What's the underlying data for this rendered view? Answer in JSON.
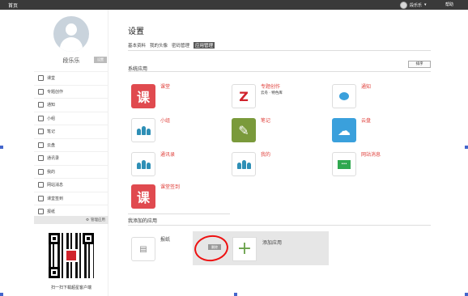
{
  "topbar": {
    "home": "首页",
    "user": "段乐乐",
    "help": "帮助"
  },
  "sidebar": {
    "username": "段乐乐",
    "settings_badge": "设置",
    "items": [
      {
        "label": "课堂",
        "icon": "book-icon"
      },
      {
        "label": "专题创作",
        "icon": "topic-icon"
      },
      {
        "label": "通知",
        "icon": "bell-icon"
      },
      {
        "label": "小组",
        "icon": "group-icon"
      },
      {
        "label": "笔记",
        "icon": "note-icon"
      },
      {
        "label": "云盘",
        "icon": "cloud-icon"
      },
      {
        "label": "通讯录",
        "icon": "contacts-icon"
      },
      {
        "label": "我的",
        "icon": "user-icon"
      },
      {
        "label": "网站消息",
        "icon": "message-icon"
      },
      {
        "label": "课堂签到",
        "icon": "checkin-icon"
      },
      {
        "label": "报纸",
        "icon": "newspaper-icon"
      }
    ],
    "manage_apps": "管理应用",
    "qr_caption": "扫一扫下载超星客户端"
  },
  "main": {
    "title": "设置",
    "tabs": [
      "基本资料",
      "我的头像",
      "密码管理",
      "应用管理"
    ],
    "active_tab": 3,
    "system_apps_label": "系统应用",
    "sort_button": "排序",
    "apps": [
      {
        "label": "课堂",
        "glyph": "课"
      },
      {
        "label": "专题创作",
        "sub": "云舟 · 特色库",
        "glyph": "Z"
      },
      {
        "label": "通知",
        "glyph": ""
      },
      {
        "label": "小组",
        "glyph": ""
      },
      {
        "label": "笔记",
        "glyph": "✎"
      },
      {
        "label": "云盘",
        "glyph": "☁"
      },
      {
        "label": "通讯录",
        "glyph": ""
      },
      {
        "label": "我的",
        "glyph": ""
      },
      {
        "label": "网站消息",
        "glyph": "…"
      },
      {
        "label": "课堂签到",
        "glyph": "课"
      }
    ],
    "added_apps_label": "我添加的应用",
    "added_app": {
      "label": "报纸"
    },
    "delete_button": "删除",
    "add_app_label": "添加应用",
    "add_glyph": "+"
  },
  "colors": {
    "accent_red": "#e04a4f",
    "note_green": "#7a9a3b",
    "cloud_blue": "#3aa0dc",
    "annotation_red": "#ee1111"
  }
}
